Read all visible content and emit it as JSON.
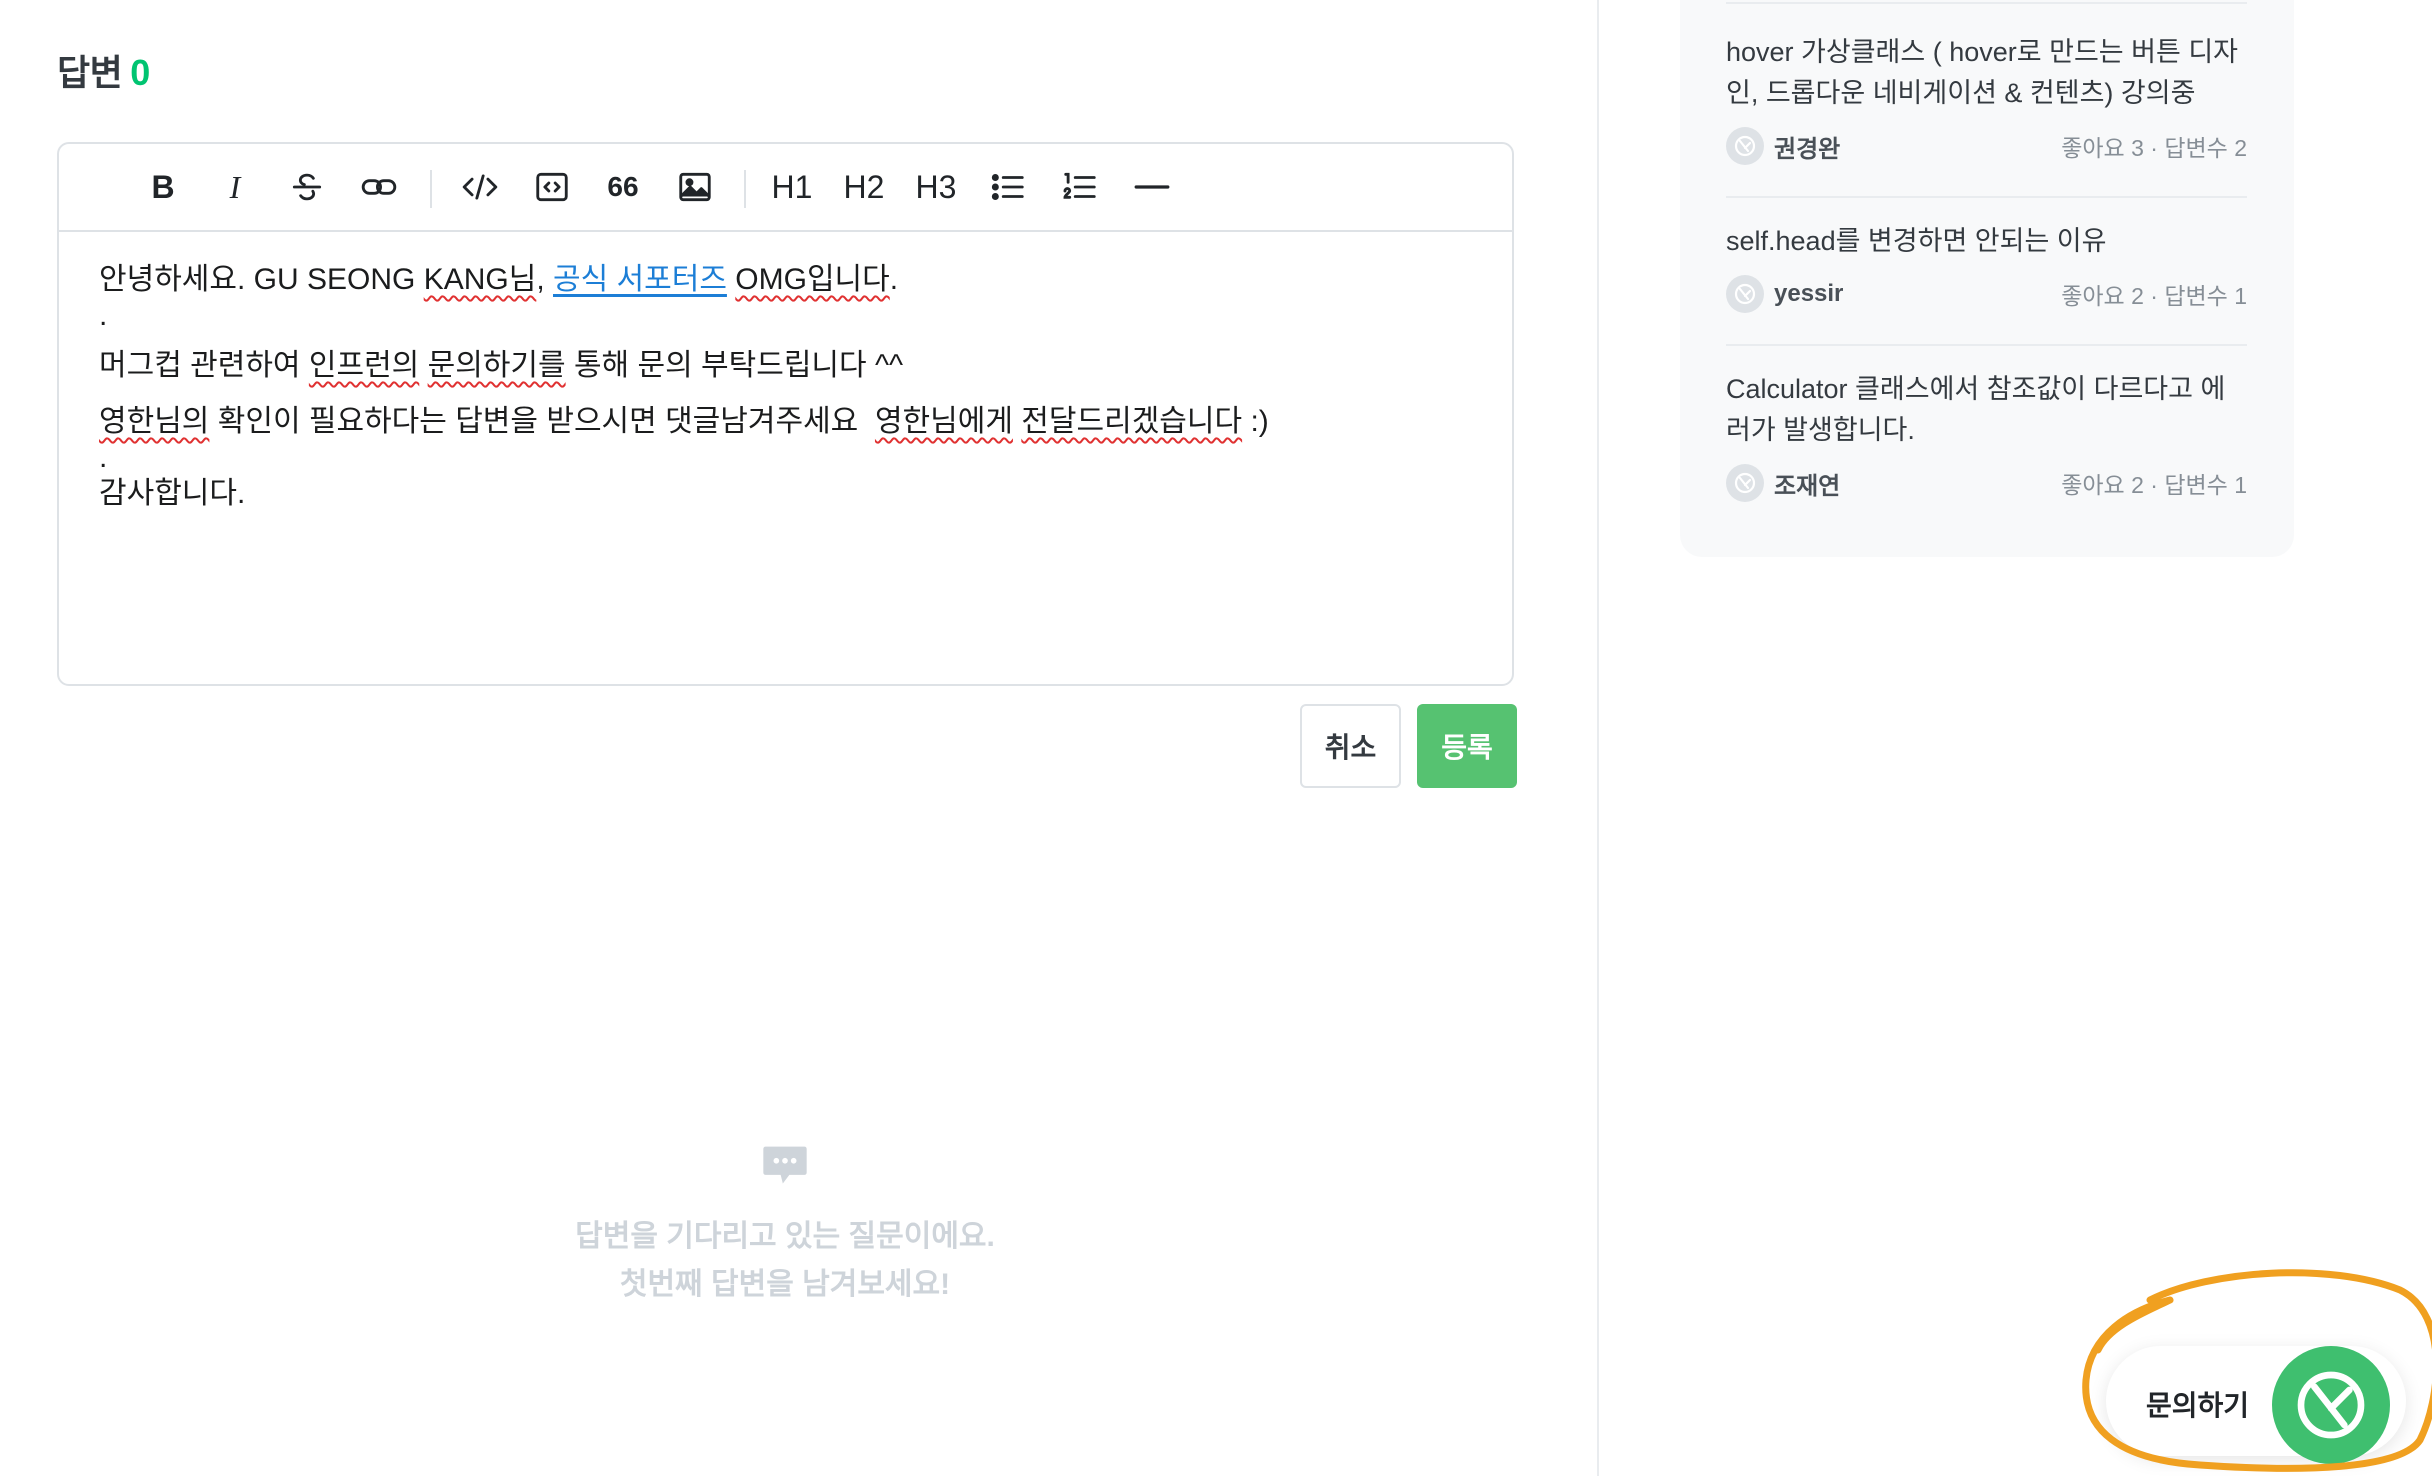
{
  "answer": {
    "heading": "답변",
    "count": "0"
  },
  "toolbar": {
    "bold": "B",
    "italic": "I",
    "quote": "66",
    "h1": "H1",
    "h2": "H2",
    "h3": "H3"
  },
  "editor": {
    "line1_pre": "안녕하세요. GU SEONG ",
    "line1_name": "KANG님",
    "line1_comma": ", ",
    "line1_link": "공식 서포터즈",
    "line1_space": " ",
    "line1_omg": "OMG입니다",
    "line1_end": ".",
    "dot1": ".",
    "line3_a": "머그컵 관련하여 ",
    "line3_b": "인프런의",
    "line3_c": " ",
    "line3_d": "문의하기를",
    "line3_e": " 통해 문의 부탁드립니다 ^^",
    "line4_a": "영한님의",
    "line4_b": " 확인이 필요하다는 답변을 받으시면 댓글남겨주세요  ",
    "line4_c": "영한님에게",
    "line4_d": " ",
    "line4_e": "전달드리겠습니다",
    "line4_f": " :)",
    "dot2": ".",
    "line6": "감사합니다."
  },
  "buttons": {
    "cancel": "취소",
    "submit": "등록"
  },
  "empty_state": {
    "line1": "답변을 기다리고 있는 질문이에요.",
    "line2": "첫번째 답변을 남겨보세요!"
  },
  "related": [
    {
      "title": "hover 가상클래스 ( hover로 만드는 버튼 디자인, 드롭다운 네비게이션 & 컨텐츠) 강의중",
      "author": "권경완",
      "stats": "좋아요 3 · 답변수 2"
    },
    {
      "title": "self.head를 변경하면 안되는 이유",
      "author": "yessir",
      "stats": "좋아요 2 · 답변수 1"
    },
    {
      "title": "Calculator 클래스에서 참조값이 다르다고 에러가 발생합니다.",
      "author": "조재연",
      "stats": "좋아요 2 · 답변수 1"
    }
  ],
  "inquiry": {
    "label": "문의하기"
  },
  "colors": {
    "accent": "#00c471",
    "submit": "#56c271",
    "annotation": "#f0a020"
  }
}
